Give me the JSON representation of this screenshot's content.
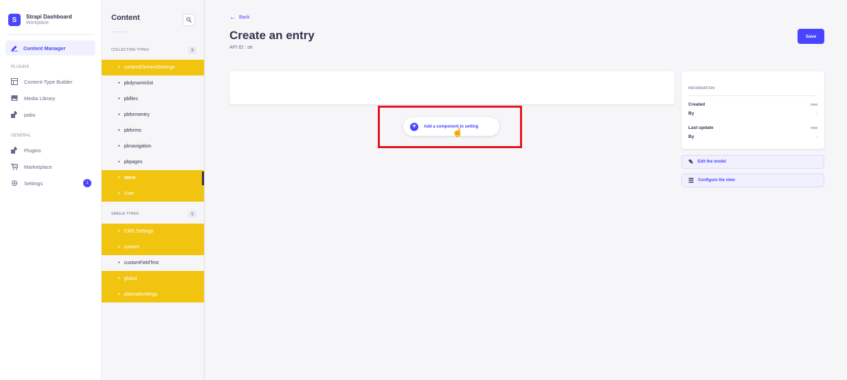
{
  "brand": {
    "title": "Strapi Dashboard",
    "subtitle": "Workplace",
    "logo": "S"
  },
  "mainnav": {
    "active": {
      "label": "Content Manager",
      "icon": "pencil-icon"
    },
    "plugins_section": "PLUGINS",
    "plugins": [
      {
        "label": "Content-Type Builder",
        "icon": "layout-icon"
      },
      {
        "label": "Media Library",
        "icon": "image-icon"
      },
      {
        "label": "pabu",
        "icon": "puzzle-icon"
      }
    ],
    "general_section": "GENERAL",
    "general": [
      {
        "label": "Plugins",
        "icon": "puzzle-icon"
      },
      {
        "label": "Marketplace",
        "icon": "cart-icon"
      },
      {
        "label": "Settings",
        "icon": "gear-icon",
        "badge": "1"
      }
    ]
  },
  "subnav": {
    "title": "Content",
    "collection_header": "COLLECTION TYPES",
    "collection_count": "9",
    "collection_items": [
      {
        "label": "contentElementSettings",
        "highlighted": true
      },
      {
        "label": "pbdynamiclist",
        "highlighted": false
      },
      {
        "label": "pbfiles",
        "highlighted": false
      },
      {
        "label": "pbformentry",
        "highlighted": false
      },
      {
        "label": "pbforms",
        "highlighted": false
      },
      {
        "label": "pbnavigation",
        "highlighted": false
      },
      {
        "label": "pbpages",
        "highlighted": false
      },
      {
        "label": "store",
        "highlighted": true,
        "selected": true
      },
      {
        "label": "User",
        "highlighted": true
      }
    ],
    "single_header": "SINGLE TYPES",
    "single_count": "5",
    "single_items": [
      {
        "label": "CMS Settings",
        "highlighted": true
      },
      {
        "label": "custom",
        "highlighted": true
      },
      {
        "label": "customFieldTest",
        "highlighted": false
      },
      {
        "label": "global",
        "highlighted": true
      },
      {
        "label": "pbemailsettings",
        "highlighted": true
      }
    ]
  },
  "main": {
    "back_label": "Back",
    "title": "Create an entry",
    "api_id": "API ID : str",
    "save_label": "Save",
    "add_component_label": "Add a component to setting"
  },
  "info": {
    "header": "INFORMATION",
    "created_label": "Created",
    "created_value": "now",
    "created_by_label": "By",
    "created_by_value": "-",
    "updated_label": "Last update",
    "updated_value": "now",
    "updated_by_label": "By",
    "updated_by_value": "-"
  },
  "actions": {
    "edit_model": "Edit the model",
    "configure_view": "Configure the view"
  },
  "colors": {
    "primary": "#4945ff",
    "highlight": "#f1c40f",
    "annotation": "#e3141b"
  }
}
